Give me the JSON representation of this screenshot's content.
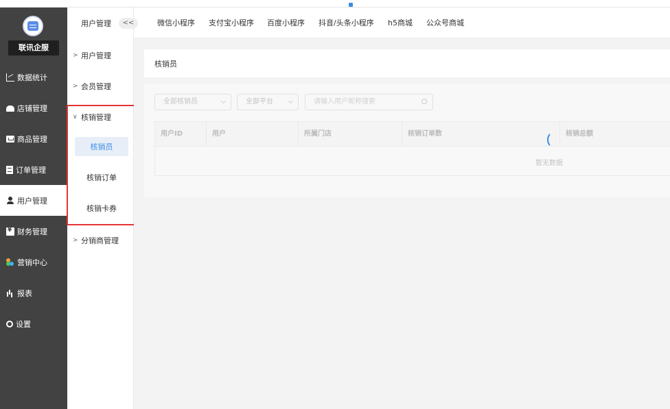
{
  "brand": {
    "name": "联讯企服"
  },
  "sidebar": {
    "items": [
      {
        "label": "数据统计",
        "icon": "chart-icon"
      },
      {
        "label": "店铺管理",
        "icon": "store-icon"
      },
      {
        "label": "商品管理",
        "icon": "goods-icon"
      },
      {
        "label": "订单管理",
        "icon": "order-icon"
      },
      {
        "label": "用户管理",
        "icon": "user-icon",
        "active": true
      },
      {
        "label": "财务管理",
        "icon": "finance-icon"
      },
      {
        "label": "营销中心",
        "icon": "marketing-icon"
      },
      {
        "label": "报表",
        "icon": "report-icon"
      },
      {
        "label": "设置",
        "icon": "settings-icon"
      }
    ]
  },
  "subnav": {
    "title": "用户管理",
    "collapse_label": "<<",
    "groups": [
      {
        "label": "用户管理",
        "expanded": false
      },
      {
        "label": "会员管理",
        "expanded": false
      },
      {
        "label": "核销管理",
        "expanded": true,
        "children": [
          "核销员",
          "核销订单",
          "核销卡券"
        ],
        "active_child": "核销员"
      },
      {
        "label": "分销商管理",
        "expanded": false
      }
    ]
  },
  "topbar": {
    "tabs": [
      "微信小程序",
      "支付宝小程序",
      "百度小程序",
      "抖音/头条小程序",
      "h5商城",
      "公众号商城"
    ]
  },
  "page": {
    "title": "核销员",
    "filters": {
      "verifier_select": "全部核销员",
      "platform_select": "全部平台",
      "search_placeholder": "请输入用户昵称搜索"
    },
    "table": {
      "columns": [
        "用户ID",
        "用户",
        "所属门店",
        "核销订单数",
        "核销总额"
      ]
    },
    "empty_text": "暂无数据"
  },
  "colors": {
    "sidebar_bg": "#424242",
    "accent": "#3a8ee6",
    "highlight": "#e53333"
  }
}
